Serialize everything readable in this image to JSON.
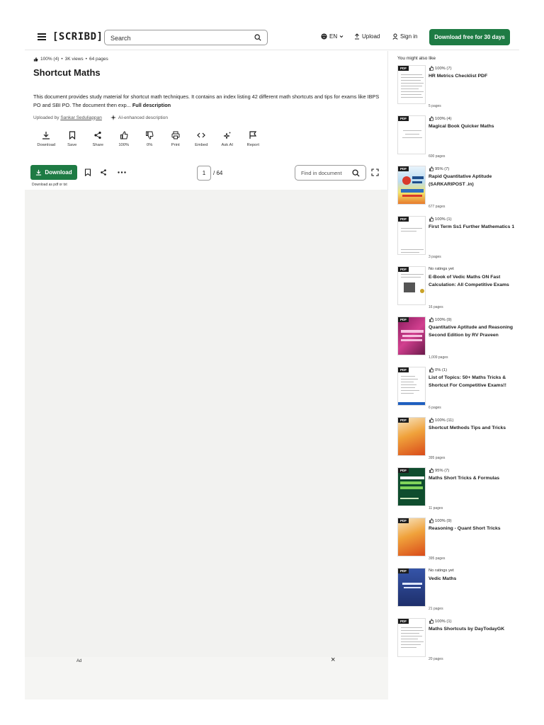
{
  "header": {
    "logo": "[SCRIBD]",
    "search_placeholder": "Search",
    "language": "EN",
    "upload": "Upload",
    "signin": "Sign in",
    "cta": "Download free for 30 days"
  },
  "doc": {
    "meta": {
      "rating": "100% (4)",
      "views": "3K views",
      "pages": "64 pages"
    },
    "title": "Shortcut Maths",
    "description": "This document provides study material for shortcut math techniques. It contains an index listing 42 different math shortcuts and tips for exams like IBPS PO and SBI PO. The document then exp...",
    "full_description": "Full description",
    "uploaded_by": "Uploaded by",
    "uploader": "Sankar Seduliappan",
    "ai_note": "AI-enhanced description"
  },
  "actions": [
    "Download",
    "Save",
    "Share",
    "100%",
    "0%",
    "Print",
    "Embed",
    "Ask AI",
    "Report"
  ],
  "toolbar": {
    "download": "Download",
    "download_note": "Download as pdf or txt",
    "page_current": "1",
    "page_total": "/ 64",
    "find_placeholder": "Find in document"
  },
  "ad": {
    "label": "Ad",
    "close": "×"
  },
  "sidebar": {
    "title": "You might also like",
    "badge": "PDF",
    "items": [
      {
        "rating": "100% (7)",
        "title": "HR Metrics Checklist PDF",
        "pages": "5 pages"
      },
      {
        "rating": "100% (4)",
        "title": "Magical Book Quicker Maths",
        "pages": "600 pages"
      },
      {
        "rating": "95% (7)",
        "title": "Rapid Quantitative Aptitude (SARKARIPOST .in)",
        "pages": "677 pages"
      },
      {
        "rating": "100% (1)",
        "title": "First Term Ss1 Further Mathematics 1",
        "pages": "3 pages"
      },
      {
        "rating": "No ratings yet",
        "title": "E-Book of Vedic Maths ON Fast Calculation: All Competitive Exams",
        "pages": "16 pages"
      },
      {
        "rating": "100% (9)",
        "title": "Quantitative Aptitude and Reasoning Second Edition by RV Praveen",
        "pages": "1,009 pages"
      },
      {
        "rating": "0% (1)",
        "title": "List of Topics: 50+ Maths Tricks & Shortcut For Competitive Exams!!",
        "pages": "6 pages"
      },
      {
        "rating": "100% (11)",
        "title": "Shortcut Methods Tips and Tricks",
        "pages": "395 pages"
      },
      {
        "rating": "95% (7)",
        "title": "Maths Short Tricks & Formulas",
        "pages": "11 pages"
      },
      {
        "rating": "100% (9)",
        "title": "Reasoning - Quant Short Tricks",
        "pages": "395 pages"
      },
      {
        "rating": "No ratings yet",
        "title": "Vedic Maths",
        "pages": "21 pages"
      },
      {
        "rating": "100% (1)",
        "title": "Maths Shortcuts by DayTodayGK",
        "pages": "20 pages"
      }
    ]
  }
}
